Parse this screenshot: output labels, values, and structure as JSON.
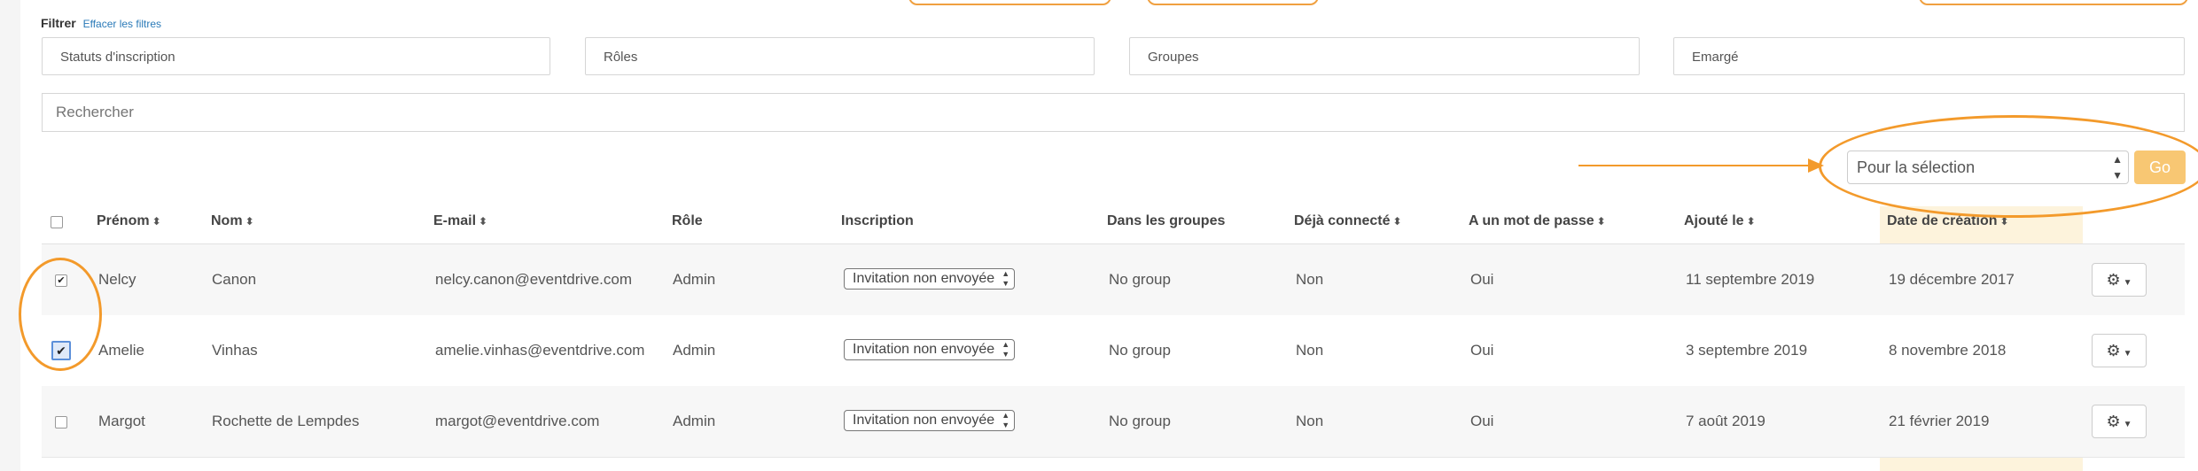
{
  "filters": {
    "label": "Filtrer",
    "clear_link": "Effacer les filtres",
    "selects": [
      "Statuts d'inscription",
      "Rôles",
      "Groupes",
      "Emargé"
    ],
    "search_placeholder": "Rechercher"
  },
  "bulk": {
    "selected": "Pour la sélection",
    "go_label": "Go"
  },
  "table": {
    "headers": {
      "firstname": "Prénom",
      "lastname": "Nom",
      "email": "E-mail",
      "role": "Rôle",
      "inscription": "Inscription",
      "groups": "Dans les groupes",
      "connected": "Déjà connecté",
      "password": "A un mot de passe",
      "added": "Ajouté le",
      "created": "Date de création"
    },
    "rows": [
      {
        "checked": true,
        "firstname": "Nelcy",
        "lastname": "Canon",
        "email": "nelcy.canon@eventdrive.com",
        "role": "Admin",
        "inscription": "Invitation non envoyée",
        "groups": "No group",
        "connected": "Non",
        "password": "Oui",
        "added": "11 septembre 2019",
        "created": "19 décembre 2017"
      },
      {
        "checked": true,
        "firstname": "Amelie",
        "lastname": "Vinhas",
        "email": "amelie.vinhas@eventdrive.com",
        "role": "Admin",
        "inscription": "Invitation non envoyée",
        "groups": "No group",
        "connected": "Non",
        "password": "Oui",
        "added": "3 septembre 2019",
        "created": "8 novembre 2018"
      },
      {
        "checked": false,
        "firstname": "Margot",
        "lastname": "Rochette de Lempdes",
        "email": "margot@eventdrive.com",
        "role": "Admin",
        "inscription": "Invitation non envoyée",
        "groups": "No group",
        "connected": "Non",
        "password": "Oui",
        "added": "7 août 2019",
        "created": "21 février 2019"
      }
    ]
  },
  "colors": {
    "annotation": "#f39a2b",
    "go_button": "#f8c773",
    "date_column_highlight": "#fdf3dc",
    "link": "#2a7ab8"
  },
  "icons": {
    "row_action": "gear-icon",
    "sort": "sort-arrows-icon"
  }
}
